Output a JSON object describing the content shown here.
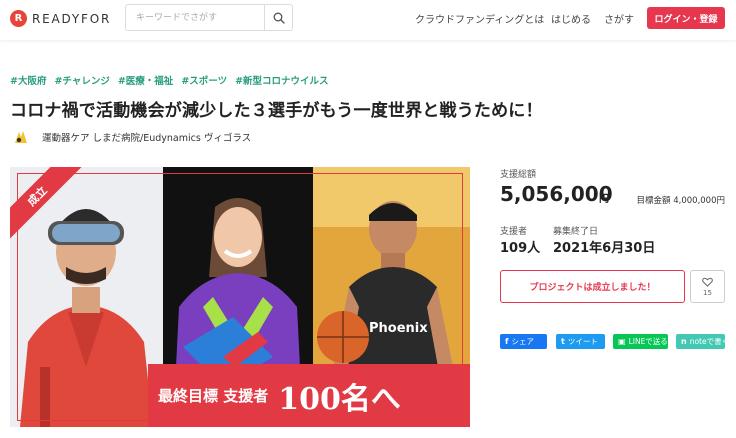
{
  "header": {
    "logo_mark": "R",
    "logo_text": "READYFOR",
    "search_placeholder": "キーワードでさがす",
    "nav": [
      "クラウドファンディングとは",
      "はじめる",
      "さがす"
    ],
    "login_label": "ログイン・登録"
  },
  "project": {
    "tags": [
      "#大阪府",
      "#チャレンジ",
      "#医療・福祉",
      "#スポーツ",
      "#新型コロナウイルス"
    ],
    "title": "コロナ禍で活動機会が減少した３選手がもう一度世界と戦うために！",
    "owner": "運動器ケア しまだ病院/Eudynamics ヴィゴラス"
  },
  "image": {
    "ribbon": "成立",
    "banner_small": "最終目標 支援者",
    "banner_big": "100名へ"
  },
  "stats": {
    "total_label": "支援総額",
    "total_amount": "5,056,000",
    "total_unit": "円",
    "goal": "目標金額 4,000,000円",
    "supporters_label": "支援者",
    "supporters_value": "109人",
    "end_label": "募集終了日",
    "end_value": "2021年6月30日"
  },
  "actions": {
    "status_label": "プロジェクトは成立しました！",
    "favorite_count": "15"
  },
  "share": {
    "facebook": "シェア",
    "twitter": "ツイート",
    "line": "LINEで送る",
    "note": "noteで書く"
  },
  "colors": {
    "brand_red": "#e6374f",
    "tag_green": "#2a9d7f",
    "facebook": "#1877f2",
    "twitter": "#1d9bf0",
    "line": "#06c755",
    "note": "#41c9b4"
  }
}
